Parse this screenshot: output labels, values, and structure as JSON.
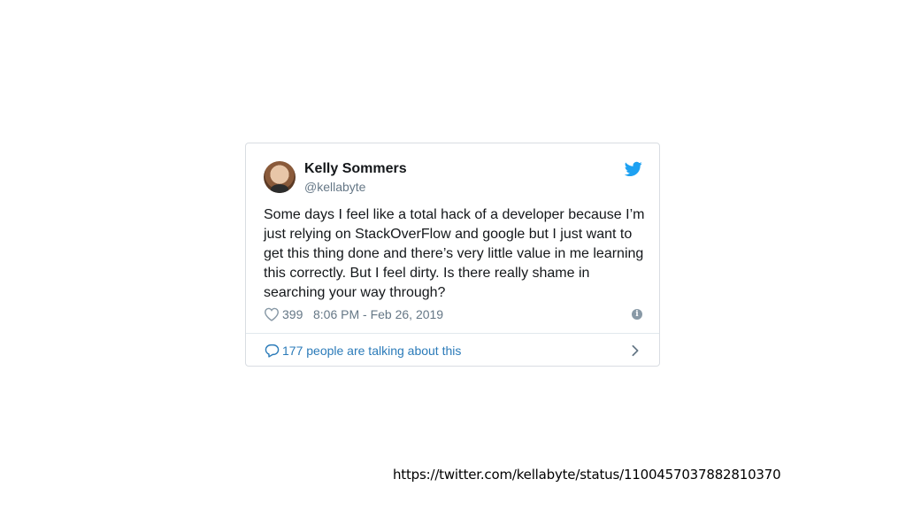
{
  "tweet": {
    "author": {
      "display_name": "Kelly Sommers",
      "handle": "@kellabyte"
    },
    "text": "Some days I feel like a total hack of a developer because I’m just relying on StackOverFlow and google but I just want to get this thing done and there’s very little value in me learning this correctly. But I feel dirty. Is there really shame in searching your way through?",
    "likes": "399",
    "timestamp": "8:06 PM - Feb 26, 2019",
    "conversation": "177 people are talking about this"
  },
  "source_url": "https://twitter.com/kellabyte/status/1100457037882810370",
  "colors": {
    "twitter_blue": "#1da1f2",
    "link_blue": "#2b7bb9",
    "muted_gray": "#657786",
    "text_dark": "#14171a"
  },
  "icons": {
    "brand": "twitter-bird-icon",
    "like": "heart-icon",
    "info": "info-icon",
    "reply": "comment-icon",
    "open": "chevron-right-icon"
  }
}
